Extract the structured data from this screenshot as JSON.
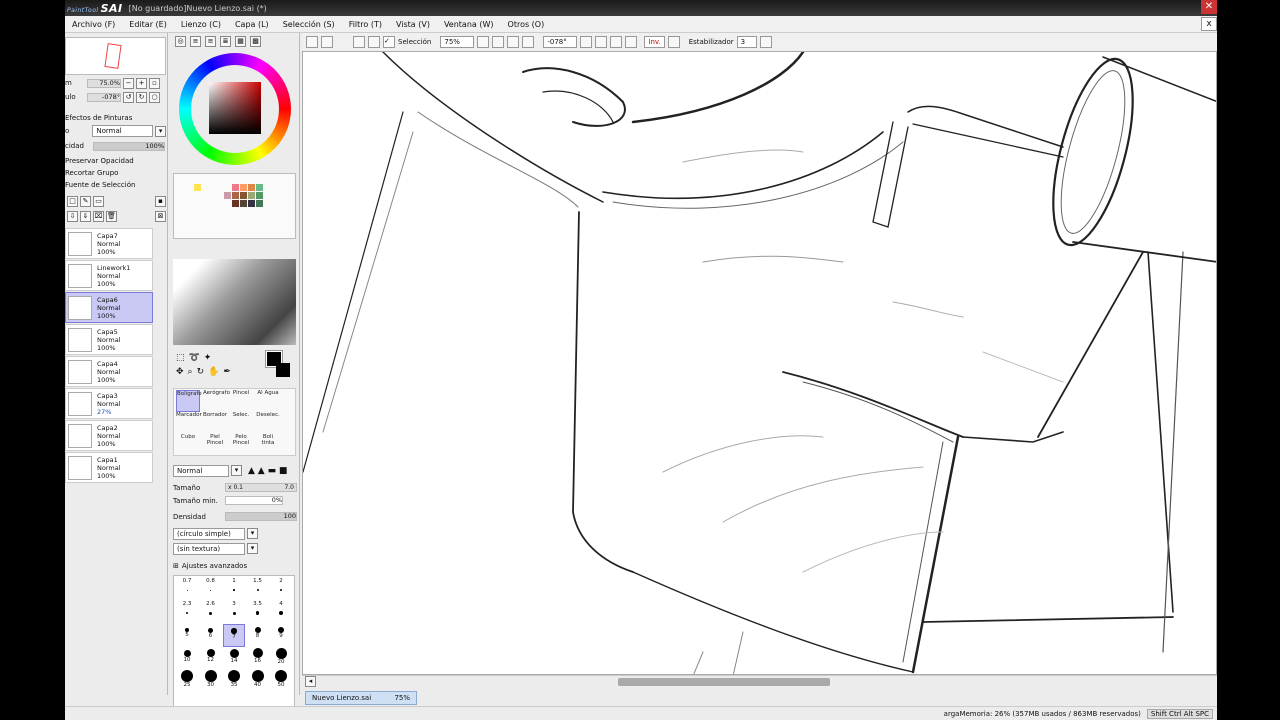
{
  "titlebar": {
    "logo": "SAI",
    "logo_small": "PaintTool",
    "title": "[No guardado]Nuevo Lienzo.sai (*)",
    "close": "✕"
  },
  "menu": [
    "Archivo (F)",
    "Editar (E)",
    "Lienzo (C)",
    "Capa (L)",
    "Selección (S)",
    "Filtro (T)",
    "Vista (V)",
    "Ventana (W)",
    "Otros (O)"
  ],
  "menu_close": "x",
  "navigator": {
    "zoom_label": "m",
    "zoom": "75.0%",
    "angle_label": "ulo",
    "angle": "-078°"
  },
  "layer_panel": {
    "effects_title": "Efectos de Pinturas",
    "mode_label": "o",
    "mode": "Normal",
    "opacity_label": "cidad",
    "opacity": "100%",
    "preserve": "Preservar Opacidad",
    "clip": "Recortar Grupo",
    "source": "Fuente de Selección",
    "layers": [
      {
        "name": "Capa7",
        "mode": "Normal",
        "opacity": "100%",
        "selected": false
      },
      {
        "name": "Linework1",
        "mode": "Normal",
        "opacity": "100%",
        "selected": false
      },
      {
        "name": "Capa6",
        "mode": "Normal",
        "opacity": "100%",
        "selected": true
      },
      {
        "name": "Capa5",
        "mode": "Normal",
        "opacity": "100%",
        "selected": false
      },
      {
        "name": "Capa4",
        "mode": "Normal",
        "opacity": "100%",
        "selected": false
      },
      {
        "name": "Capa3",
        "mode": "Normal",
        "opacity": "27%",
        "selected": false
      },
      {
        "name": "Capa2",
        "mode": "Normal",
        "opacity": "100%",
        "selected": false
      },
      {
        "name": "Capa1",
        "mode": "Normal",
        "opacity": "100%",
        "selected": false
      }
    ]
  },
  "tools": {
    "items": [
      {
        "label": "Bolígrafo",
        "selected": true
      },
      {
        "label": "Aerógrafo",
        "selected": false
      },
      {
        "label": "Pincel",
        "selected": false
      },
      {
        "label": "Al Agua",
        "selected": false
      },
      {
        "label": "Marcador",
        "selected": false
      },
      {
        "label": "Borrador",
        "selected": false
      },
      {
        "label": "Selec.",
        "selected": false
      },
      {
        "label": "Deselec.",
        "selected": false
      },
      {
        "label": "Cubo",
        "selected": false
      },
      {
        "label": "Piel Pincel",
        "selected": false
      },
      {
        "label": "Pelo Pincel",
        "selected": false
      },
      {
        "label": "Boli tinta",
        "selected": false
      }
    ]
  },
  "brush": {
    "blend_mode": "Normal",
    "size_label": "Tamaño",
    "size_mult": "x 0.1",
    "size_value": "7.0",
    "min_size_label": "Tamaño min.",
    "min_size_value": "0%",
    "density_label": "Densidad",
    "density_value": "100",
    "shape": "(círculo simple)",
    "texture": "(sin textura)",
    "advanced": "Ajustes avanzados",
    "presets": [
      "0.7",
      "0.8",
      "1",
      "1.5",
      "2",
      "2.3",
      "2.6",
      "3",
      "3.5",
      "4",
      "5",
      "6",
      "7",
      "8",
      "9",
      "10",
      "12",
      "14",
      "16",
      "20",
      "25",
      "30",
      "35",
      "40",
      "50"
    ],
    "selected_preset": "7"
  },
  "toolbar": {
    "selection_label": "Selección",
    "zoom": "75%",
    "angle": "-078°",
    "invert": "Inv.",
    "stabilizer_label": "Estabilizador",
    "stabilizer": "3"
  },
  "tabs": [
    {
      "name": "Nuevo Lienzo.sai",
      "zoom": "75%"
    }
  ],
  "status": {
    "memory": "argaMemoria: 26% (357MB usados / 863MB reservados)",
    "keys": "Shift Ctrl Alt SPC"
  },
  "colors": {
    "accent_selected": "#c9c9f3",
    "fg": "#000000",
    "bg": "#000000"
  }
}
